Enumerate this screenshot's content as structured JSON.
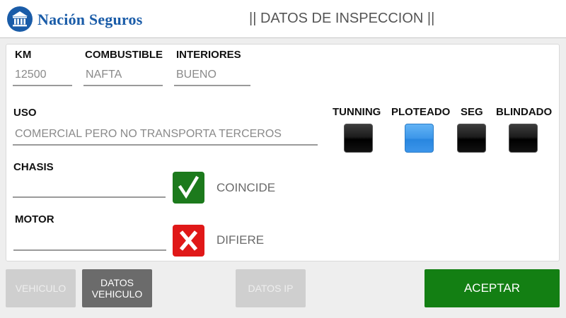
{
  "header": {
    "brand": "Nación Seguros",
    "brand_icon": "bank-building-icon",
    "title": "|| DATOS DE INSPECCION ||"
  },
  "form": {
    "km": {
      "label": "KM",
      "value": "12500"
    },
    "combustible": {
      "label": "COMBUSTIBLE",
      "value": "NAFTA"
    },
    "interiores": {
      "label": "INTERIORES",
      "value": "BUENO"
    },
    "uso": {
      "label": "USO",
      "value": "COMERCIAL PERO NO TRANSPORTA TERCEROS"
    },
    "chasis": {
      "label": "CHASIS",
      "value": "",
      "status": "COINCIDE",
      "status_icon": "check-icon"
    },
    "motor": {
      "label": "MOTOR",
      "value": "",
      "status": "DIFIERE",
      "status_icon": "x-icon"
    }
  },
  "toggles": [
    {
      "label": "TUNNING",
      "checked": false
    },
    {
      "label": "PLOTEADO",
      "checked": true
    },
    {
      "label": "SEG",
      "checked": false
    },
    {
      "label": "BLINDADO",
      "checked": false
    }
  ],
  "buttons": {
    "vehiculo": "VEHICULO",
    "datos_vehiculo_line1": "DATOS",
    "datos_vehiculo_line2": "VEHICULO",
    "datos_ip": "DATOS IP",
    "aceptar": "ACEPTAR"
  },
  "colors": {
    "brand_blue": "#1a5ca8",
    "ok_green": "#1c7a1c",
    "error_red": "#e01818",
    "toggle_on_blue": "#3d97e9",
    "accept_green": "#137f13"
  }
}
